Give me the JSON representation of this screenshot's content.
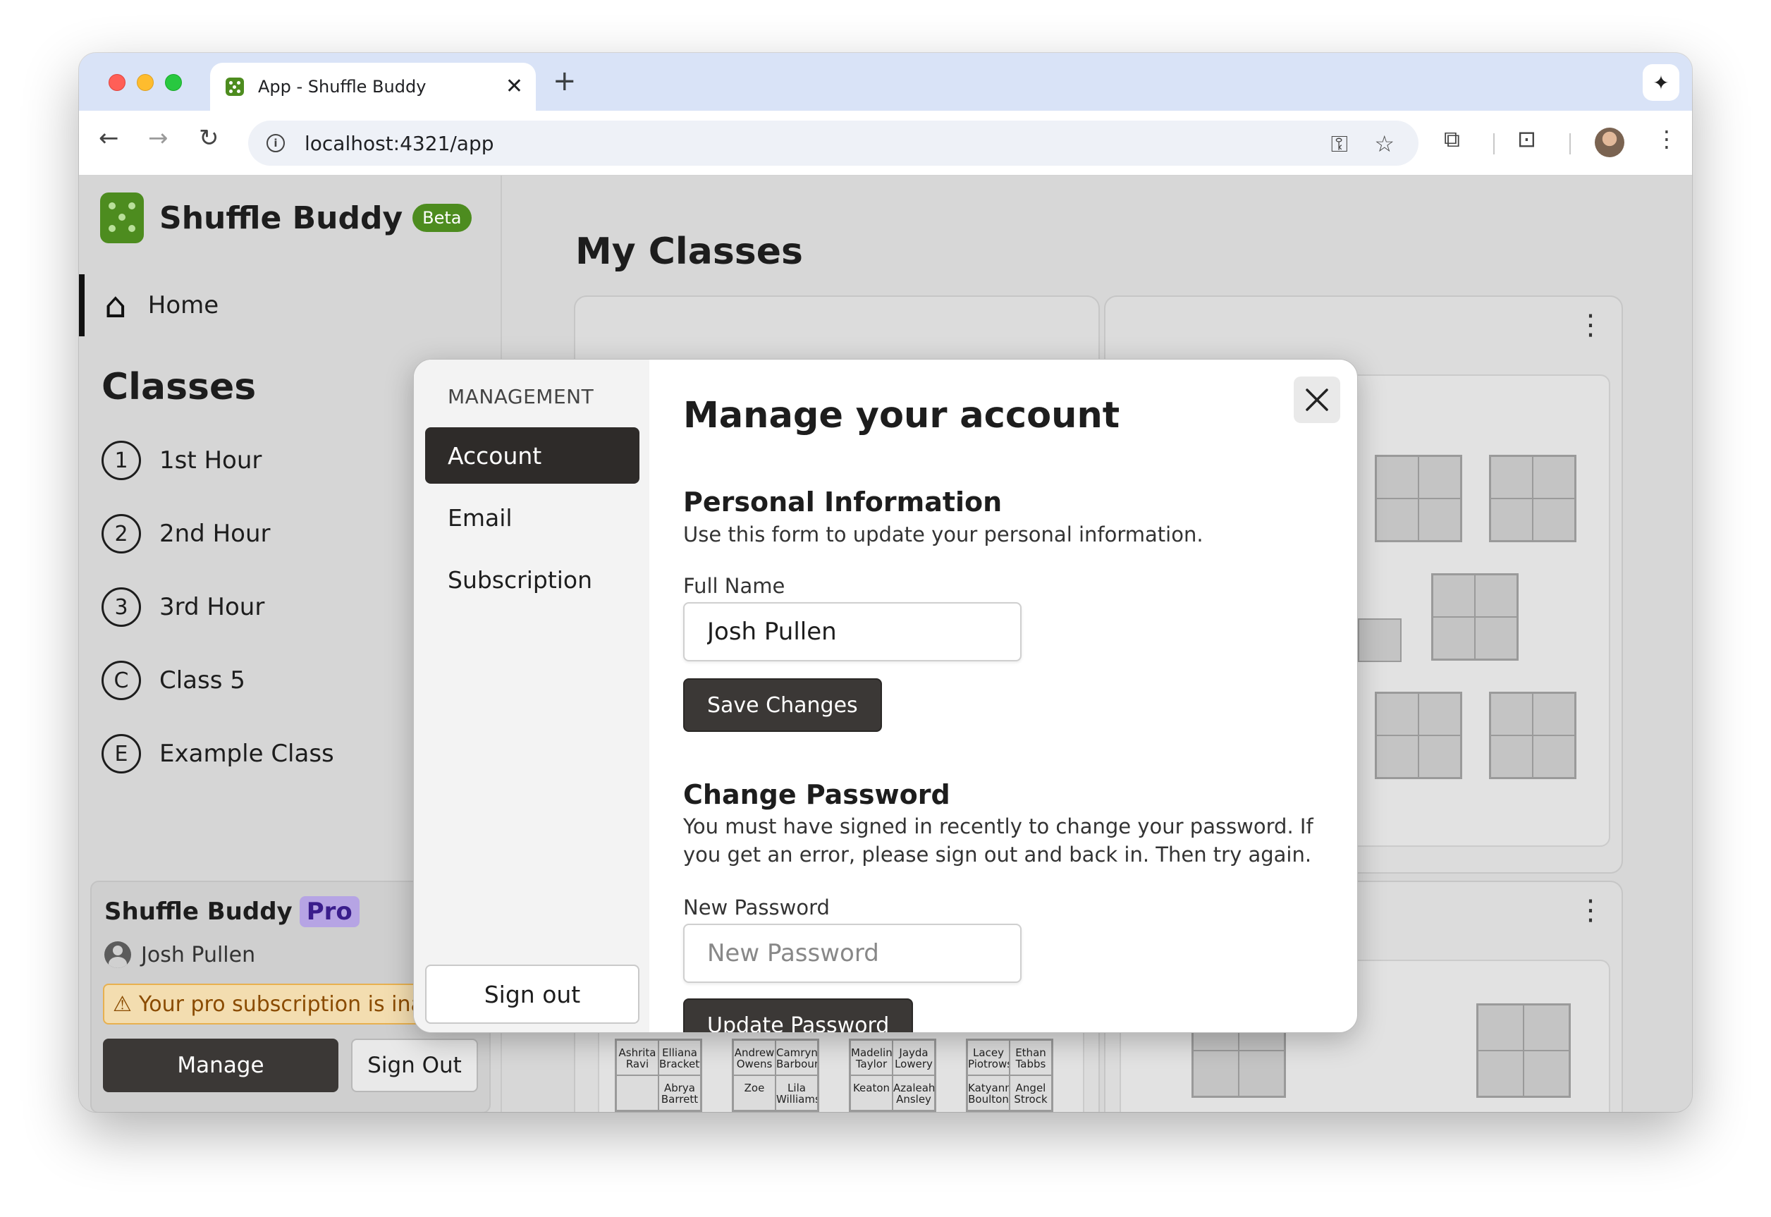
{
  "browser": {
    "tab_title": "App - Shuffle Buddy",
    "url": "localhost:4321/app"
  },
  "sidebar": {
    "brand": "Shuffle Buddy",
    "beta": "Beta",
    "home": "Home",
    "classes_heading": "Classes",
    "classes": [
      {
        "badge": "1",
        "label": "1st Hour"
      },
      {
        "badge": "2",
        "label": "2nd Hour"
      },
      {
        "badge": "3",
        "label": "3rd Hour"
      },
      {
        "badge": "C",
        "label": "Class 5"
      },
      {
        "badge": "E",
        "label": "Example Class"
      }
    ],
    "pro": {
      "title": "Shuffle Buddy",
      "badge": "Pro",
      "user": "Josh Pullen",
      "warning": "Your pro subscription is inactive",
      "manage": "Manage",
      "sign_out": "Sign Out"
    }
  },
  "main": {
    "title": "My Classes",
    "seats": [
      [
        "Ashrita Ravi",
        "Elliana Brackett",
        "",
        "Abrya Barrett"
      ],
      [
        "Andrew Owens",
        "Camryn Barbour",
        "Zoe",
        "Lila Williams"
      ],
      [
        "Madeline Taylor",
        "Jayda Lowery",
        "Keaton",
        "Azaleah Ansley"
      ],
      [
        "Lacey Piotrowski",
        "Ethan Tabbs",
        "Katyanna Boulton",
        "Angel Strock"
      ]
    ]
  },
  "modal": {
    "section_label": "MANAGEMENT",
    "nav": [
      "Account",
      "Email",
      "Subscription"
    ],
    "sign_out": "Sign out",
    "title": "Manage your account",
    "personal_heading": "Personal Information",
    "personal_desc": "Use this form to update your personal information.",
    "full_name_label": "Full Name",
    "full_name_value": "Josh Pullen",
    "save": "Save Changes",
    "password_heading": "Change Password",
    "password_desc": "You must have signed in recently to change your password. If you get an error, please sign out and back in. Then try again.",
    "new_password_label": "New Password",
    "new_password_placeholder": "New Password",
    "update": "Update Password"
  }
}
